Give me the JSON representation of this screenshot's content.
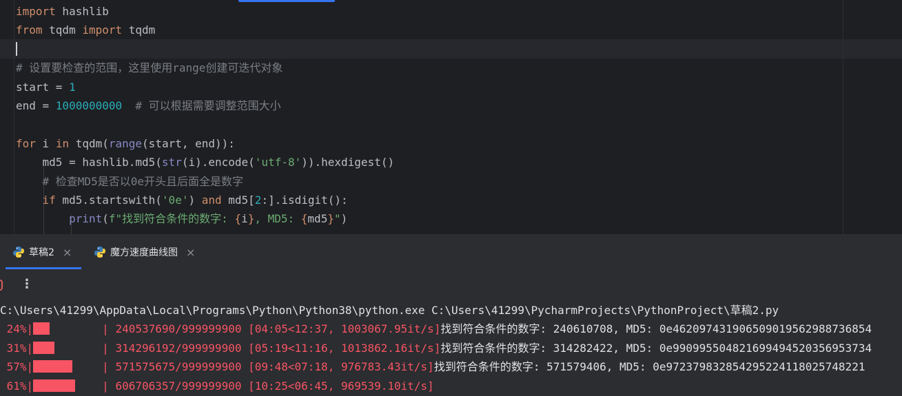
{
  "editor": {
    "lines": [
      {
        "parts": [
          {
            "t": "import",
            "c": "kw"
          },
          {
            "t": " hashlib",
            "c": ""
          }
        ]
      },
      {
        "parts": [
          {
            "t": "from",
            "c": "kw"
          },
          {
            "t": " tqdm ",
            "c": ""
          },
          {
            "t": "import",
            "c": "kw"
          },
          {
            "t": " tqdm",
            "c": ""
          }
        ]
      },
      {
        "parts": []
      },
      {
        "parts": [
          {
            "t": "# 设置要检查的范围，这里使用range创建可迭代对象",
            "c": "cmt"
          }
        ]
      },
      {
        "parts": [
          {
            "t": "start = ",
            "c": ""
          },
          {
            "t": "1",
            "c": "num"
          }
        ]
      },
      {
        "parts": [
          {
            "t": "end = ",
            "c": ""
          },
          {
            "t": "1000000000",
            "c": "num"
          },
          {
            "t": "  # 可以根据需要调整范围大小",
            "c": "cmt"
          }
        ]
      },
      {
        "parts": []
      },
      {
        "parts": [
          {
            "t": "for",
            "c": "kw"
          },
          {
            "t": " i ",
            "c": ""
          },
          {
            "t": "in",
            "c": "kw"
          },
          {
            "t": " tqdm(",
            "c": ""
          },
          {
            "t": "range",
            "c": "bi"
          },
          {
            "t": "(start, end)):",
            "c": ""
          }
        ]
      },
      {
        "parts": [
          {
            "t": "    md5 = hashlib.md5(",
            "c": ""
          },
          {
            "t": "str",
            "c": "bi"
          },
          {
            "t": "(i).encode(",
            "c": ""
          },
          {
            "t": "'utf-8'",
            "c": "str"
          },
          {
            "t": ")).hexdigest()",
            "c": ""
          }
        ]
      },
      {
        "parts": [
          {
            "t": "    # 检查MD5是否以0e开头且后面全是数字",
            "c": "cmt"
          }
        ]
      },
      {
        "parts": [
          {
            "t": "    ",
            "c": ""
          },
          {
            "t": "if",
            "c": "kw"
          },
          {
            "t": " md5.startswith(",
            "c": ""
          },
          {
            "t": "'0e'",
            "c": "str"
          },
          {
            "t": ") ",
            "c": ""
          },
          {
            "t": "and",
            "c": "kw"
          },
          {
            "t": " md5[",
            "c": ""
          },
          {
            "t": "2",
            "c": "num"
          },
          {
            "t": ":].isdigit():",
            "c": ""
          }
        ]
      },
      {
        "parts": [
          {
            "t": "        ",
            "c": ""
          },
          {
            "t": "print",
            "c": "bi"
          },
          {
            "t": "(",
            "c": ""
          },
          {
            "t": "f\"找到符合条件的数字: ",
            "c": "fs"
          },
          {
            "t": "{",
            "c": "br"
          },
          {
            "t": "i",
            "c": ""
          },
          {
            "t": "}",
            "c": "br"
          },
          {
            "t": ", MD5: ",
            "c": "fs"
          },
          {
            "t": "{",
            "c": "br"
          },
          {
            "t": "md5",
            "c": ""
          },
          {
            "t": "}",
            "c": "br"
          },
          {
            "t": "\"",
            "c": "fs"
          },
          {
            "t": ")",
            "c": ""
          }
        ]
      }
    ]
  },
  "tabs": [
    {
      "label": "草稿2",
      "close": "×"
    },
    {
      "label": "魔方速度曲线图",
      "close": "×"
    }
  ],
  "toolbar": {
    "more_icon": "⋮"
  },
  "console": {
    "command": "C:\\Users\\41299\\AppData\\Local\\Programs\\Python\\Python38\\python.exe C:\\Users\\41299\\PycharmProjects\\PythonProject\\草稿2.py",
    "progress": [
      {
        "pct": " 24%|",
        "fill": 0.24,
        "pad": "     ",
        "stats": "| 240537690/999999900 [04:05<12:37, 1003067.95it/s]",
        "found": "找到符合条件的数字: 240610708, MD5: 0e462097431906509019562988736854"
      },
      {
        "pct": " 31%|",
        "fill": 0.31,
        "pad": "     ",
        "stats": "| 314296192/999999900 [05:19<11:16, 1013862.16it/s]",
        "found": "找到符合条件的数字: 314282422, MD5: 0e990995504821699494520356953734"
      },
      {
        "pct": " 57%|",
        "fill": 0.57,
        "pad": "     ",
        "stats": "| 571575675/999999900 [09:48<07:18, 976783.43it/s]",
        "found": "找到符合条件的数字: 571579406, MD5: 0e972379832854295224118025748221"
      },
      {
        "pct": " 61%|",
        "fill": 0.61,
        "pad": "     ",
        "stats": "| 606706357/999999900 [10:25<06:45, 969539.10it/s]",
        "found": ""
      }
    ]
  },
  "colors": {
    "keyword": "#cf8e6d",
    "number": "#2aacb8",
    "string": "#6aab73",
    "comment": "#7a7e85",
    "builtin": "#8888c6",
    "progress": "#f75464",
    "accent": "#3574f0"
  }
}
